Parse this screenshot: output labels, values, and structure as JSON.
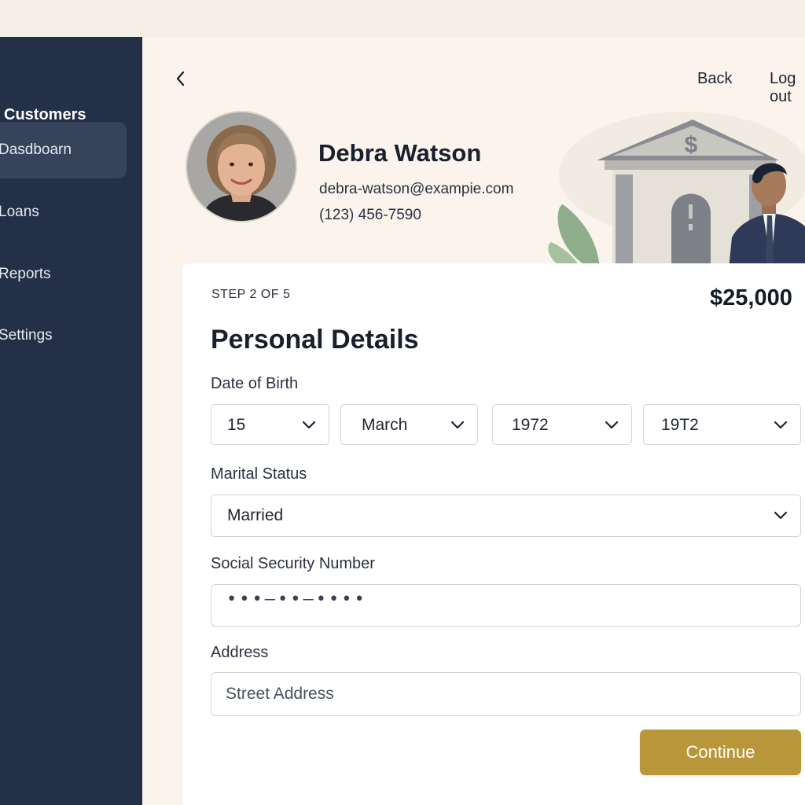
{
  "sidebar": {
    "title": "Customers",
    "items": [
      {
        "label": "Dasdboarn",
        "active": true
      },
      {
        "label": "Loans",
        "active": false
      },
      {
        "label": "Reports",
        "active": false
      },
      {
        "label": "Settings",
        "active": false
      }
    ]
  },
  "header": {
    "back_label": "Back",
    "logout_label": "Log out",
    "back_icon": "chevron-left-icon"
  },
  "customer": {
    "name": "Debra Watson",
    "email": "debra-watson@exampie.com",
    "phone": "(123) 456-7590"
  },
  "form": {
    "step": "STEP 2 OF 5",
    "amount": "$25,000",
    "title": "Personal Details",
    "dob_label": "Date of Birth",
    "dob_day": "15",
    "dob_month": "March",
    "dob_year": "1972",
    "dob_extra": "19T2",
    "marital_label": "Marital Status",
    "marital_value": "Married",
    "ssn_label": "Social Security Number",
    "ssn_masked": "•••–••–••••",
    "address_label": "Address",
    "address_placeholder": "Street Address",
    "continue_label": "Continue"
  },
  "colors": {
    "sidebar_bg": "#243048",
    "accent": "#b8963a",
    "page_bg": "#faf4ec"
  }
}
